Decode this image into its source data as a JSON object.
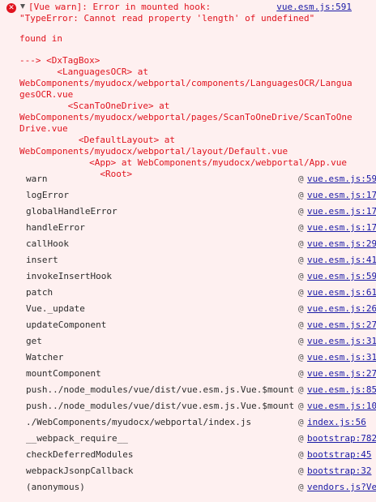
{
  "error": {
    "icon": "error-icon",
    "line1": "[Vue warn]: Error in mounted hook:",
    "line2": "\"TypeError: Cannot read property 'length' of undefined\"",
    "source": "vue.esm.js:591",
    "found_in": "found in",
    "trace": [
      "---> <DxTagBox>",
      "       <LanguagesOCR> at",
      "WebComponents/myudocx/webportal/components/LanguagesOCR/Langua",
      "gesOCR.vue",
      "         <ScanToOneDrive> at",
      "WebComponents/myudocx/webportal/pages/ScanToOneDrive/ScanToOne",
      "Drive.vue",
      "           <DefaultLayout> at",
      "WebComponents/myudocx/webportal/layout/Default.vue",
      "             <App> at WebComponents/myudocx/webportal/App.vue",
      "               <Root>"
    ]
  },
  "stack": [
    {
      "fn": "warn",
      "loc": "vue.esm.js:59"
    },
    {
      "fn": "logError",
      "loc": "vue.esm.js:17"
    },
    {
      "fn": "globalHandleError",
      "loc": "vue.esm.js:17"
    },
    {
      "fn": "handleError",
      "loc": "vue.esm.js:17"
    },
    {
      "fn": "callHook",
      "loc": "vue.esm.js:29"
    },
    {
      "fn": "insert",
      "loc": "vue.esm.js:41"
    },
    {
      "fn": "invokeInsertHook",
      "loc": "vue.esm.js:59"
    },
    {
      "fn": "patch",
      "loc": "vue.esm.js:61"
    },
    {
      "fn": "Vue._update",
      "loc": "vue.esm.js:26"
    },
    {
      "fn": "updateComponent",
      "loc": "vue.esm.js:27"
    },
    {
      "fn": "get",
      "loc": "vue.esm.js:31"
    },
    {
      "fn": "Watcher",
      "loc": "vue.esm.js:31"
    },
    {
      "fn": "mountComponent",
      "loc": "vue.esm.js:27"
    },
    {
      "fn": "push../node_modules/vue/dist/vue.esm.js.Vue.$mount",
      "loc": "vue.esm.js:85"
    },
    {
      "fn": "push../node_modules/vue/dist/vue.esm.js.Vue.$mount",
      "loc": "vue.esm.js:10"
    },
    {
      "fn": "./WebComponents/myudocx/webportal/index.js",
      "loc": "index.js:56"
    },
    {
      "fn": "__webpack_require__",
      "loc": "bootstrap:782"
    },
    {
      "fn": "checkDeferredModules",
      "loc": "bootstrap:45"
    },
    {
      "fn": "webpackJsonpCallback",
      "loc": "bootstrap:32"
    },
    {
      "fn": "(anonymous)",
      "loc": "vendors.js?Ve"
    }
  ],
  "at_symbol": "@",
  "colors": {
    "background": "#fef0f0",
    "error_text": "#e0131e",
    "link": "#1a1aa6",
    "stack_text": "#2b2b2b"
  }
}
